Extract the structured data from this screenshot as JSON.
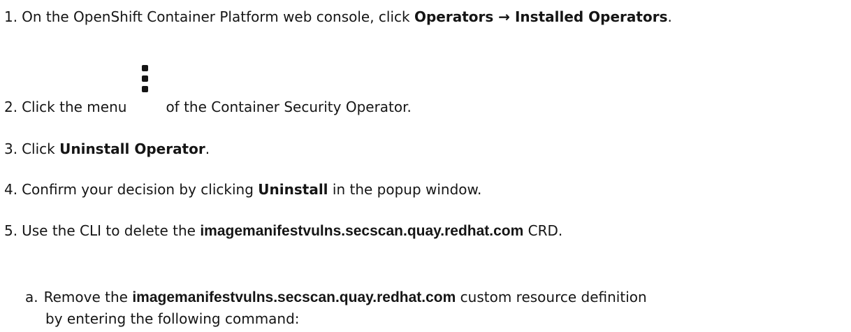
{
  "steps": [
    {
      "num": "1.",
      "pre": "On the OpenShift Container Platform web console, click ",
      "gui": "Operators → Installed Operators",
      "post": "."
    },
    {
      "num": "2.",
      "pre": "Click the menu",
      "icon": "kebab-menu-icon",
      "post": "of the Container Security Operator."
    },
    {
      "num": "3.",
      "pre": "Click ",
      "gui": "Uninstall Operator",
      "post": "."
    },
    {
      "num": "4.",
      "pre": "Confirm your decision by clicking ",
      "gui": "Uninstall",
      "post": " in the popup window."
    },
    {
      "num": "5.",
      "pre": "Use the CLI to delete the ",
      "strong": "imagemanifestvulns.secscan.quay.redhat.com",
      "post": " CRD."
    }
  ],
  "substep": {
    "num": "a.",
    "pre": "Remove the ",
    "strong": "imagemanifestvulns.secscan.quay.redhat.com",
    "post": " custom resource definition",
    "cont": "by entering the following command:"
  }
}
